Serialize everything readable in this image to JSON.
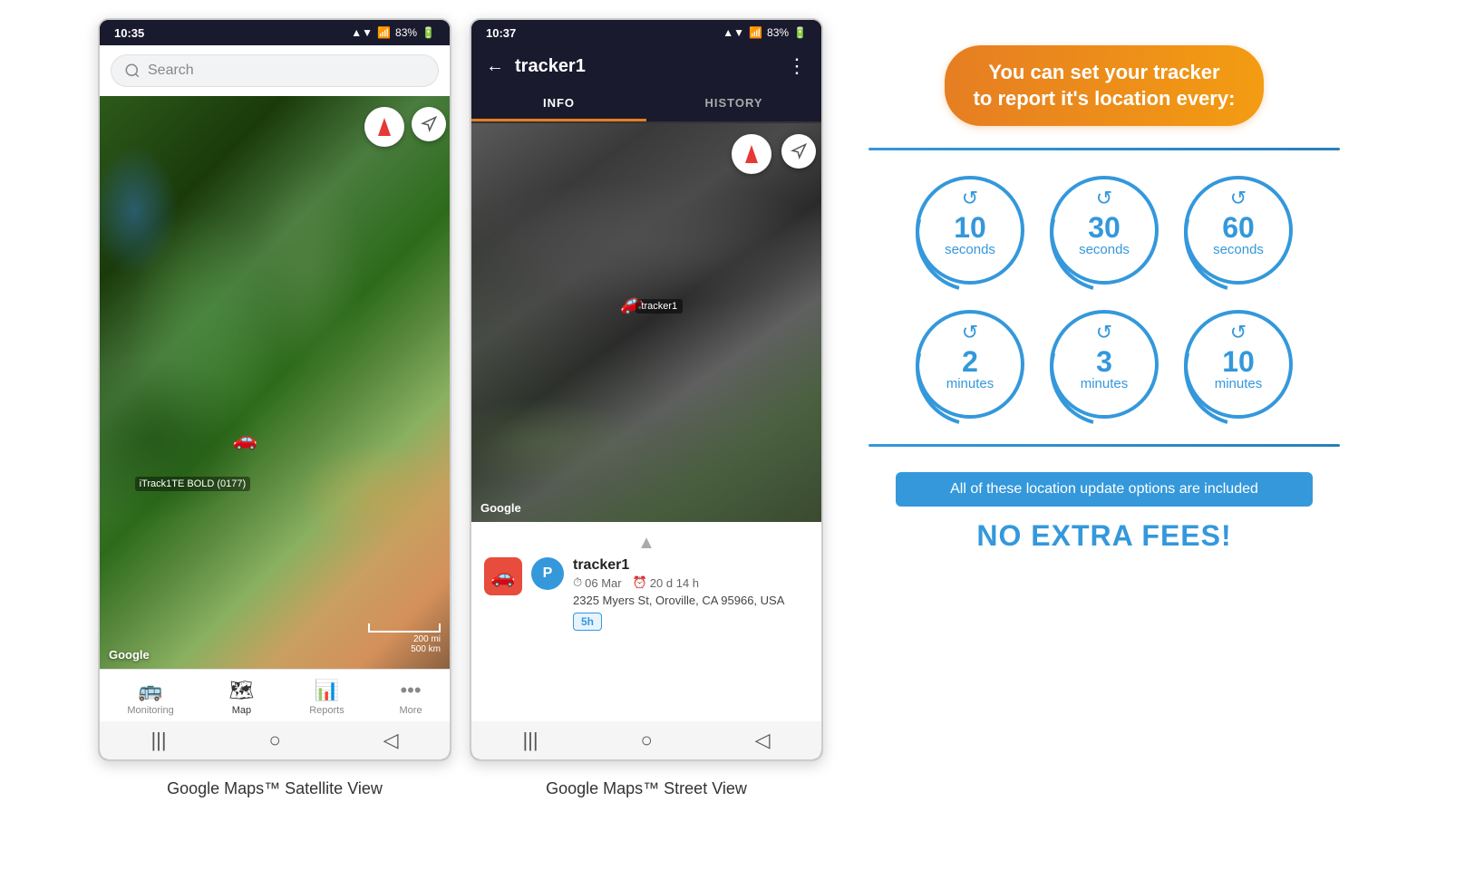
{
  "phone1": {
    "statusBar": {
      "time": "10:35",
      "signal": "▲▼ .ull 83%"
    },
    "search": {
      "placeholder": "Search"
    },
    "mapLabel": "iTrack1TE BOLD (0177)",
    "googleLogo": "Google",
    "scale200": "200 mi",
    "scale500": "500 km",
    "navItems": [
      {
        "icon": "🚌",
        "label": "Monitoring",
        "active": false
      },
      {
        "icon": "🗺",
        "label": "Map",
        "active": true
      },
      {
        "icon": "📊",
        "label": "Reports",
        "active": false
      },
      {
        "icon": "•••",
        "label": "More",
        "active": false
      }
    ],
    "caption": "Google Maps™ Satellite View"
  },
  "phone2": {
    "statusBar": {
      "time": "10:37",
      "signal": "▲▼ .ull 83%"
    },
    "header": {
      "title": "tracker1"
    },
    "tabs": [
      {
        "label": "INFO",
        "active": true
      },
      {
        "label": "HISTORY",
        "active": false
      }
    ],
    "googleLogo": "Google",
    "trackerName": "tracker1",
    "trackerDate": "06 Mar",
    "trackerDuration": "20 d 14 h",
    "trackerAddress": "2325 Myers St, Oroville, CA 95966, USA",
    "trackerBadge": "5h",
    "caption": "Google Maps™ Street View"
  },
  "intervals": {
    "headerLine1": "You can set your tracker",
    "headerLine2": "to report it's location every:",
    "circles": [
      {
        "number": "10",
        "unit": "seconds"
      },
      {
        "number": "30",
        "unit": "seconds"
      },
      {
        "number": "60",
        "unit": "seconds"
      },
      {
        "number": "2",
        "unit": "minutes"
      },
      {
        "number": "3",
        "unit": "minutes"
      },
      {
        "number": "10",
        "unit": "minutes"
      }
    ],
    "includedBanner": "All of these location update options are included",
    "noExtraFees": "NO EXTRA FEES!"
  }
}
